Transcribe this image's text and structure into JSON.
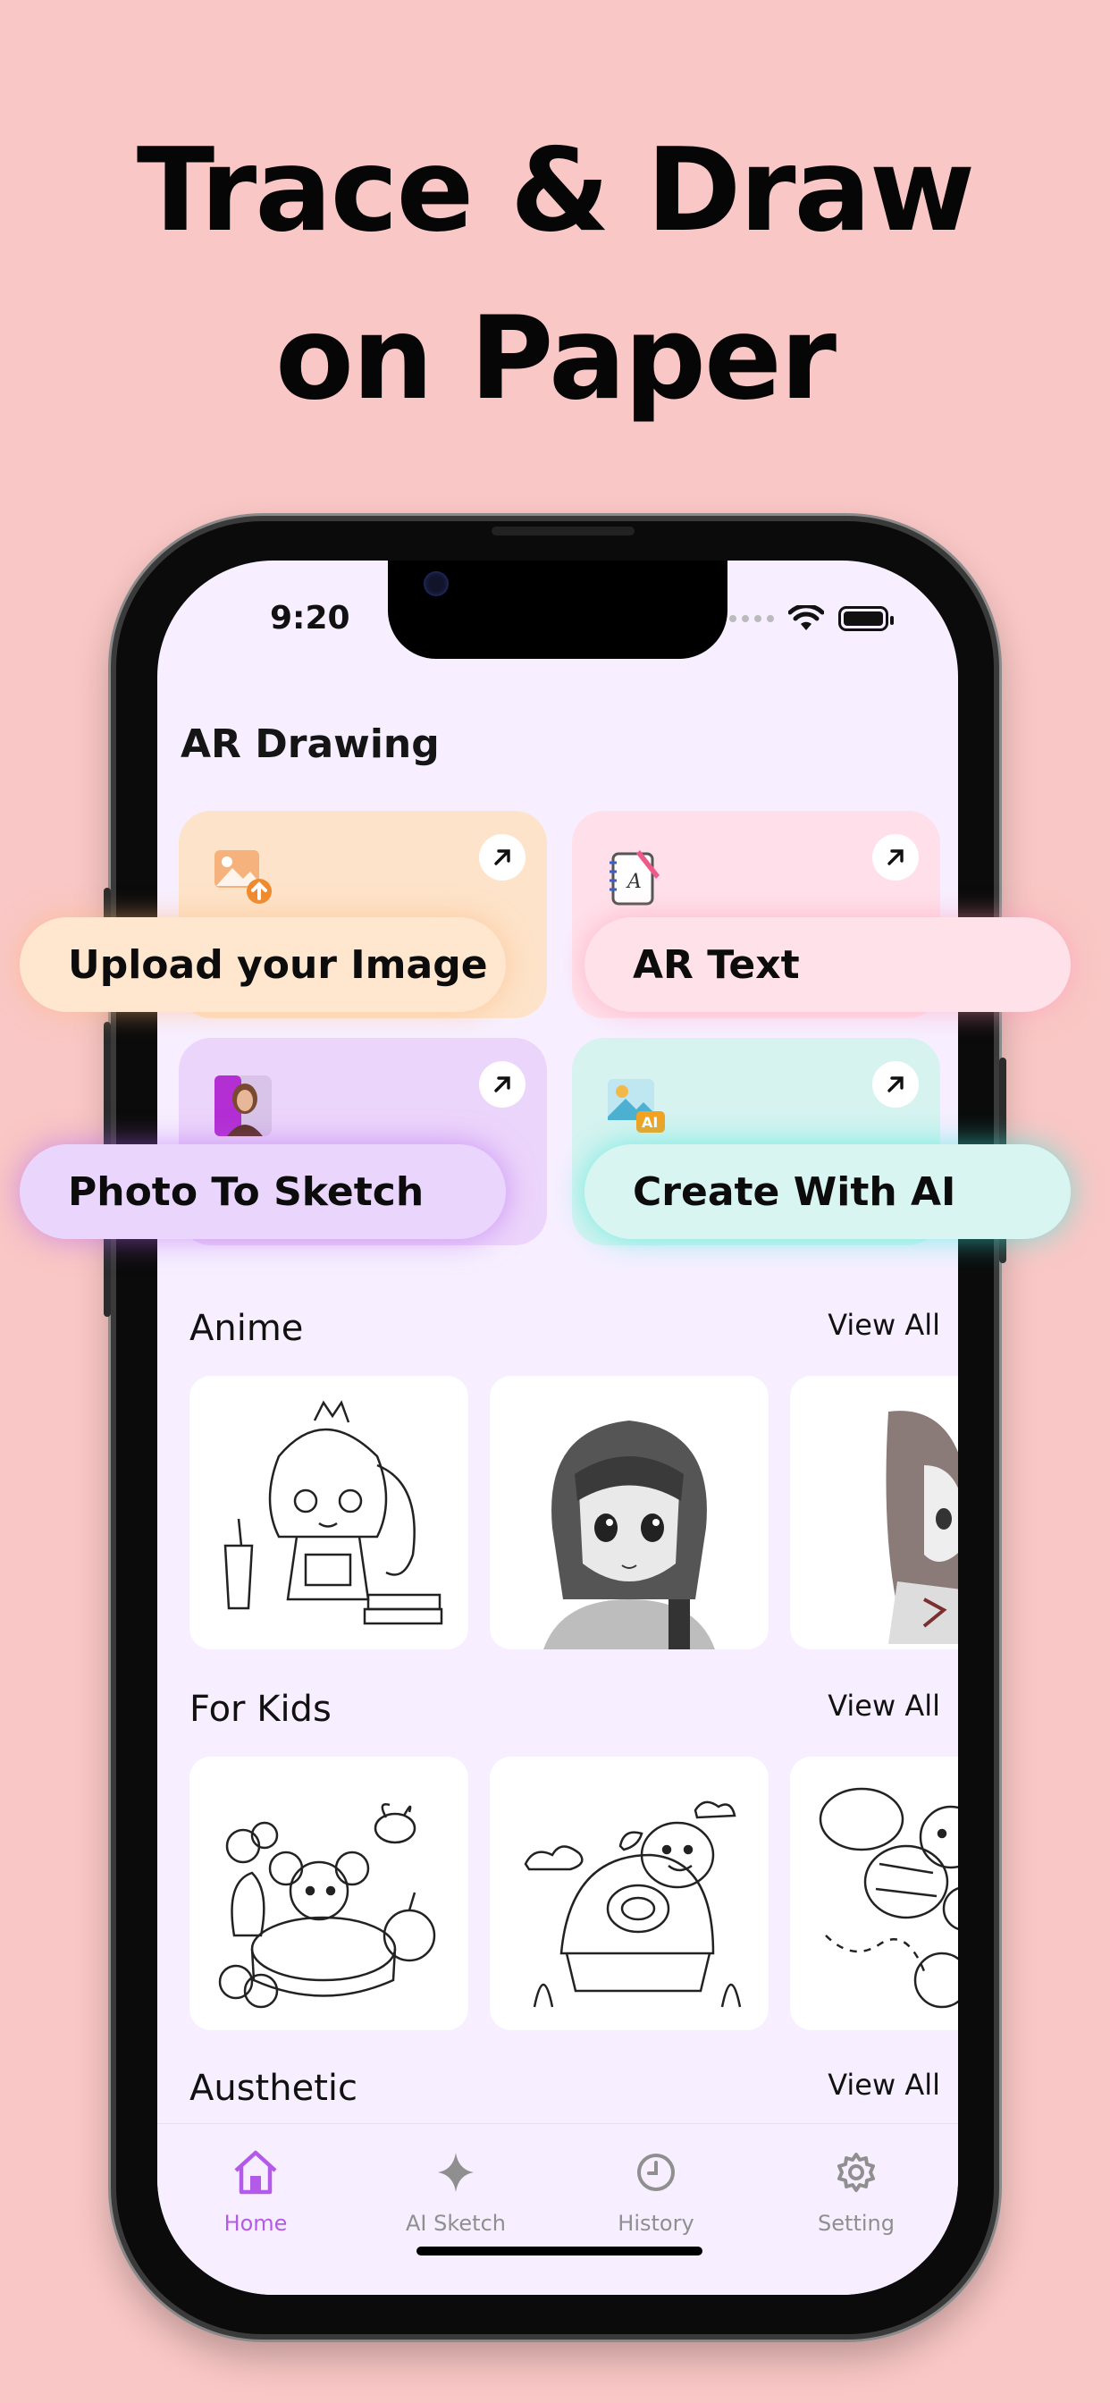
{
  "headline": {
    "line1": "Trace & Draw",
    "line2": "on Paper"
  },
  "status": {
    "time": "9:20"
  },
  "app": {
    "title": "AR Drawing"
  },
  "cards": [
    {
      "label": "Upload your Image",
      "icon": "image-upload-icon",
      "color": "#fde3c9",
      "pill_color": "#ffe6cf"
    },
    {
      "label": "AR Text",
      "icon": "notebook-pen-icon",
      "color": "#ffe0ea",
      "pill_color": "#ffe1ea"
    },
    {
      "label": "Photo To Sketch",
      "icon": "portrait-sketch-icon",
      "color": "#ecd5fb",
      "pill_color": "#ead6fc"
    },
    {
      "label": "Create With AI",
      "icon": "ai-image-icon",
      "color": "#d6f3f0",
      "pill_color": "#d9f5f2"
    }
  ],
  "sections": [
    {
      "title": "Anime",
      "view_all": "View All"
    },
    {
      "title": "For Kids",
      "view_all": "View All"
    },
    {
      "title": "Austhetic",
      "view_all": "View All"
    }
  ],
  "tabs": [
    {
      "label": "Home",
      "icon": "home-icon",
      "active": true
    },
    {
      "label": "AI Sketch",
      "icon": "sparkle-icon",
      "active": false
    },
    {
      "label": "History",
      "icon": "clock-icon",
      "active": false
    },
    {
      "label": "Setting",
      "icon": "gear-icon",
      "active": false
    }
  ],
  "colors": {
    "background": "#f9c7c5",
    "accent": "#b35ae8",
    "inactive": "#8f8f8f"
  }
}
